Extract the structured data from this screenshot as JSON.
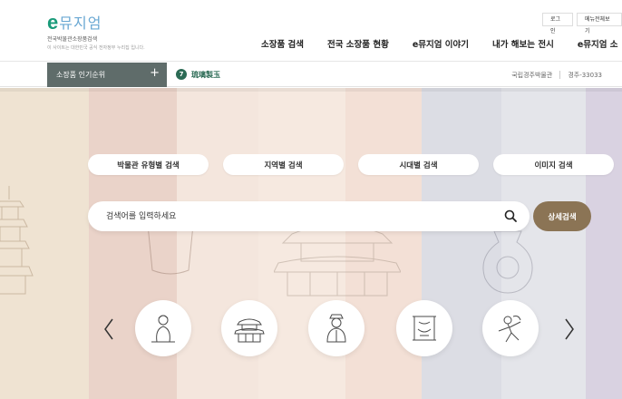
{
  "logo": {
    "e": "e",
    "name": "뮤지엄",
    "subtitle": "전국박물관소장품검색",
    "tagline": "이 사이트는 대한민국 공식 전자정부 누리집 입니다."
  },
  "util": {
    "login": "로그인",
    "sitemap": "메뉴전체보기"
  },
  "gnb": {
    "items": [
      "소장품 검색",
      "전국 소장품 현황",
      "e뮤지엄 이야기",
      "내가 해보는 전시",
      "e뮤지엄 소"
    ]
  },
  "subbar": {
    "popular_label": "소장품 인기순위",
    "plus": "+",
    "rank_number": "7",
    "rank_text": "琉璃製玉",
    "museum": "국립경주박물관",
    "artifact_id": "경주-33033"
  },
  "categories": [
    "박물관 유형별 검색",
    "지역별 검색",
    "시대별 검색",
    "이미지 검색"
  ],
  "search": {
    "placeholder": "검색어를 입력하세요",
    "detail_button": "상세검색"
  },
  "carousel": {
    "items": [
      "buddha-icon",
      "palace-icon",
      "figure-icon",
      "scroll-icon",
      "dancer-icon"
    ]
  },
  "colors": {
    "brand_green": "#1a9b7a",
    "accent_brown": "#8b7455",
    "bar_gray": "#5f6c6a"
  }
}
